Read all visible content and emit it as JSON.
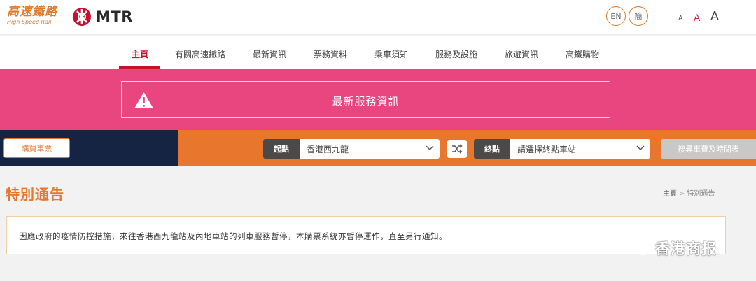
{
  "header": {
    "hsr_logo_cn": "高速鐵路",
    "hsr_logo_en": "High Speed Rail",
    "mtr_logo_text": "MTR",
    "lang_en": "EN",
    "lang_tc": "簡",
    "font_small": "A",
    "font_medium": "A",
    "font_large": "A"
  },
  "nav": {
    "items": [
      {
        "label": "主頁",
        "active": true
      },
      {
        "label": "有關高速鐵路"
      },
      {
        "label": "最新資訊"
      },
      {
        "label": "票務資料"
      },
      {
        "label": "乘車須知"
      },
      {
        "label": "服務及設施"
      },
      {
        "label": "旅遊資訊"
      },
      {
        "label": "高鐵購物"
      }
    ]
  },
  "banner": {
    "notice_label": "最新服務資訊",
    "icon": "warning-icon"
  },
  "booking": {
    "buy_ticket_label": "購買車票",
    "origin_label": "起點",
    "origin_value": "香港西九龍",
    "destination_label": "終點",
    "destination_placeholder": "請選擇終點車站",
    "search_label": "搜尋車費及時間表",
    "swap_icon": "swap-icon"
  },
  "page": {
    "title": "特別通告",
    "breadcrumb": {
      "home": "主頁",
      "separator": ">",
      "current": "特別通告"
    },
    "message": "因應政府的疫情防控措施，來往香港西九龍站及內地車站的列車服務暫停，本購票系統亦暫停運作，直至另行通知。"
  },
  "watermark": {
    "text": "香港商报"
  },
  "colors": {
    "brand_orange": "#e8762d",
    "brand_red": "#c8102e",
    "banner_pink": "#e9467f",
    "navy": "#152443"
  }
}
